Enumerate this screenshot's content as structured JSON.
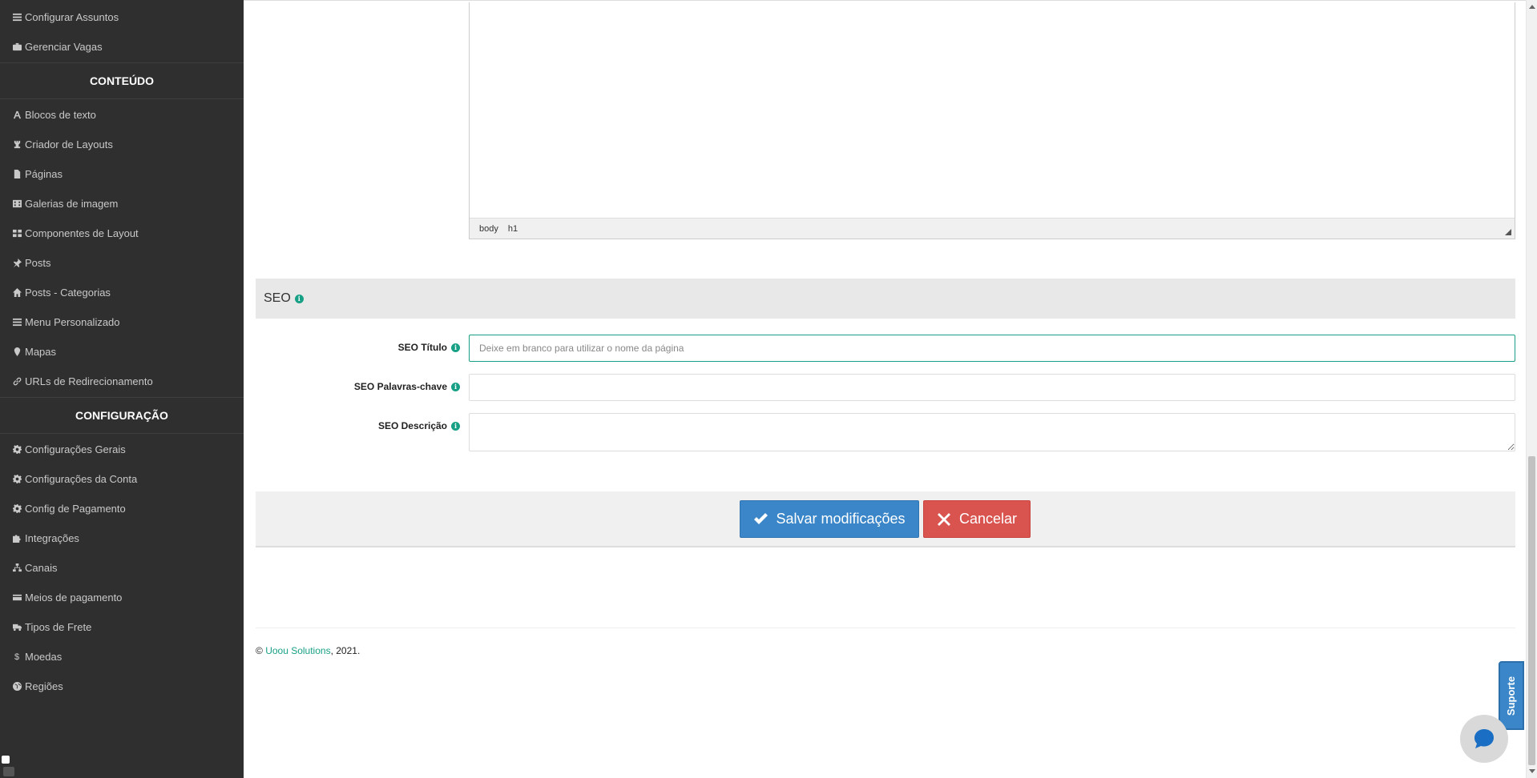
{
  "sidebar": {
    "items_top": [
      {
        "label": "Configurar Assuntos",
        "icon": "list-icon"
      },
      {
        "label": "Gerenciar Vagas",
        "icon": "briefcase-icon"
      }
    ],
    "section_content": "CONTEÚDO",
    "items_content": [
      {
        "label": "Blocos de texto",
        "icon": "font-icon"
      },
      {
        "label": "Criador de Layouts",
        "icon": "chess-rook-icon"
      },
      {
        "label": "Páginas",
        "icon": "file-icon"
      },
      {
        "label": "Galerias de imagem",
        "icon": "film-icon"
      },
      {
        "label": "Componentes de Layout",
        "icon": "grid-icon"
      },
      {
        "label": "Posts",
        "icon": "pin-icon"
      },
      {
        "label": "Posts - Categorias",
        "icon": "home-icon"
      },
      {
        "label": "Menu Personalizado",
        "icon": "list-icon"
      },
      {
        "label": "Mapas",
        "icon": "map-marker-icon"
      },
      {
        "label": "URLs de Redirecionamento",
        "icon": "link-icon"
      }
    ],
    "section_config": "CONFIGURAÇÃO",
    "items_config": [
      {
        "label": "Configurações Gerais",
        "icon": "gear-icon"
      },
      {
        "label": "Configurações da Conta",
        "icon": "gear-icon"
      },
      {
        "label": "Config de Pagamento",
        "icon": "gear-icon"
      },
      {
        "label": "Integrações",
        "icon": "puzzle-icon"
      },
      {
        "label": "Canais",
        "icon": "sitemap-icon"
      },
      {
        "label": "Meios de pagamento",
        "icon": "credit-card-icon"
      },
      {
        "label": "Tipos de Frete",
        "icon": "truck-icon"
      },
      {
        "label": "Moedas",
        "icon": "dollar-icon"
      },
      {
        "label": "Regiões",
        "icon": "globe-icon"
      }
    ]
  },
  "editor": {
    "path": [
      "body",
      "h1"
    ]
  },
  "seo": {
    "heading": "SEO",
    "title_label": "SEO Título",
    "title_placeholder": "Deixe em branco para utilizar o nome da página",
    "keywords_label": "SEO Palavras-chave",
    "description_label": "SEO Descrição"
  },
  "actions": {
    "save_label": "Salvar modificações",
    "cancel_label": "Cancelar"
  },
  "footer": {
    "copyright": "©",
    "company": "Uoou Solutions",
    "year": ", 2021."
  },
  "support": {
    "label": "Suporte"
  },
  "colors": {
    "sidebar_bg": "#2f2f2f",
    "accent": "#17a085",
    "save_button": "#3a86c8",
    "cancel_button": "#d9534f"
  }
}
